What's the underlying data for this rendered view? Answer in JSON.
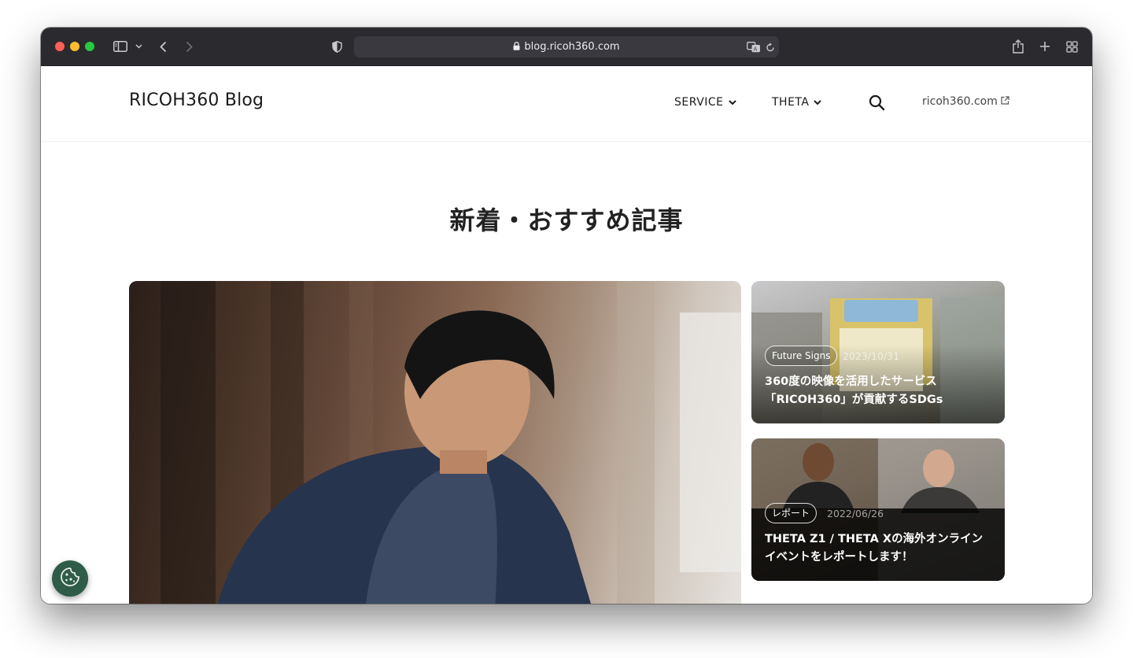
{
  "browser": {
    "url": "blog.ricoh360.com"
  },
  "header": {
    "logo": "RICOH360 Blog",
    "nav": [
      {
        "label": "SERVICE"
      },
      {
        "label": "THETA"
      }
    ],
    "external_link": "ricoh360.com"
  },
  "main": {
    "section_title": "新着・おすすめ記事",
    "cards": [
      {
        "tag": "Future Signs",
        "date": "2023/10/31",
        "title": "360度の映像を活用したサービス「RICOH360」が貢献するSDGs"
      },
      {
        "tag": "レポート",
        "date": "2022/06/26",
        "title": "THETA Z1 / THETA Xの海外オンラインイベントをレポートします！"
      }
    ]
  },
  "colors": {
    "toolbar": "#2b2a2f",
    "cookie_button": "#2e5c48"
  }
}
